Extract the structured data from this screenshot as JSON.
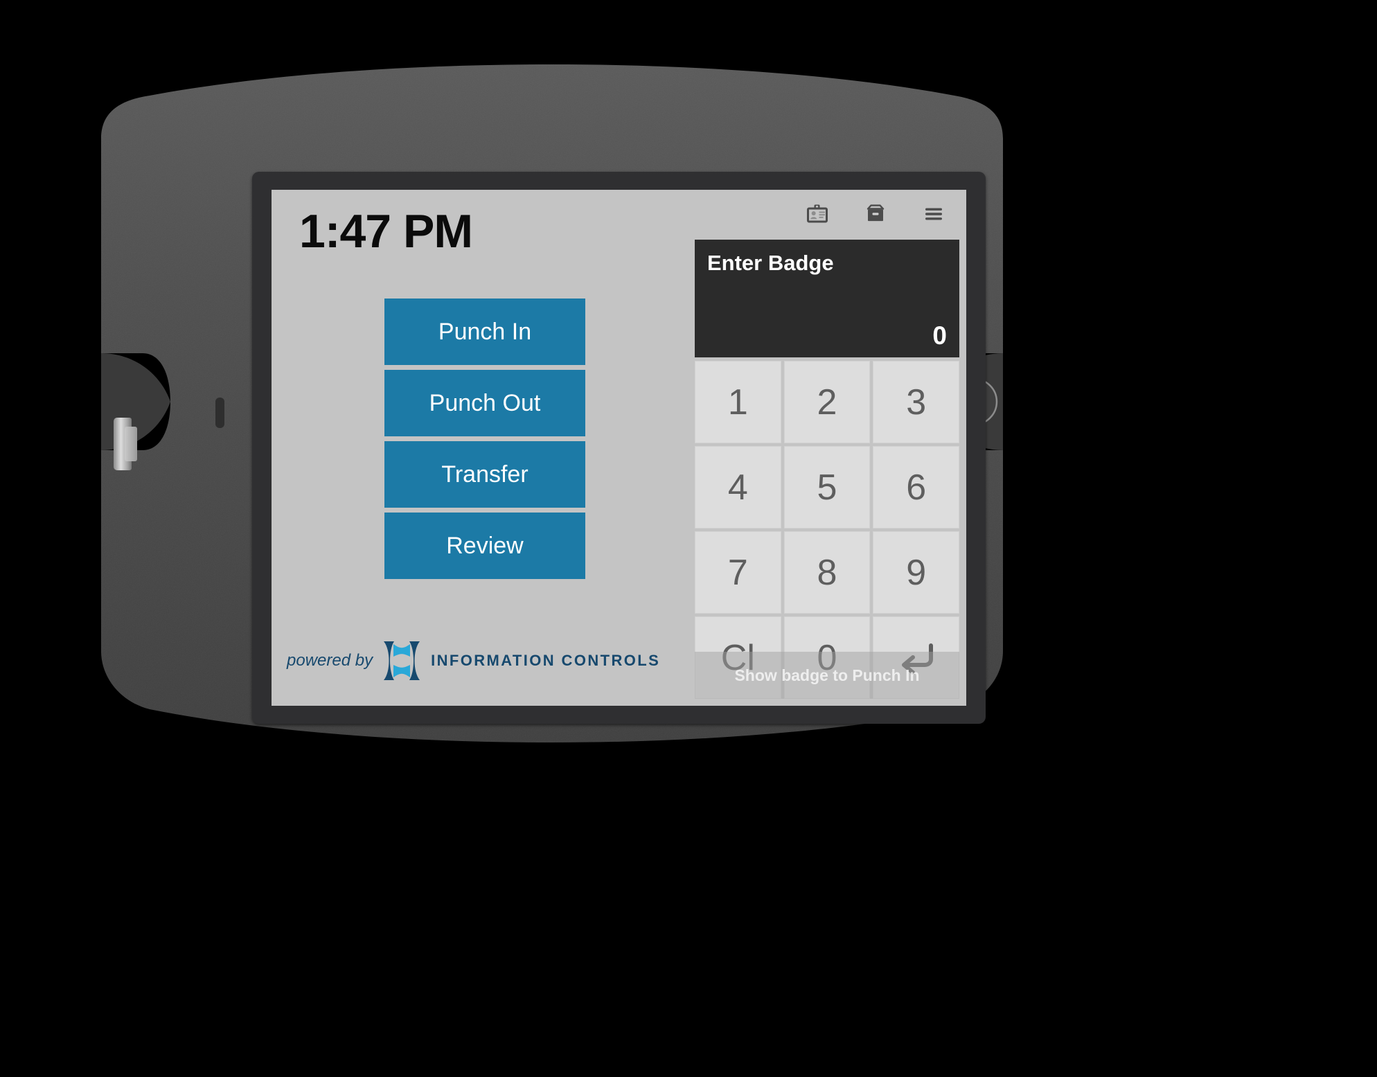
{
  "device": {
    "type": "tablet-kiosk-enclosure",
    "shell_color": "#4b4b4b",
    "bezel_color": "#2f2f31"
  },
  "screen": {
    "background": "#c4c4c4",
    "accent_color": "#1c7aa6",
    "panel_color": "#2b2b2b",
    "key_color": "#dddddd"
  },
  "header": {
    "clock": "1:47 PM",
    "icons": [
      {
        "name": "badge-icon",
        "label": "Badge"
      },
      {
        "name": "archive-box-icon",
        "label": "Archive"
      },
      {
        "name": "hamburger-menu-icon",
        "label": "Menu"
      }
    ]
  },
  "actions": [
    {
      "label": "Punch In"
    },
    {
      "label": "Punch Out"
    },
    {
      "label": "Transfer"
    },
    {
      "label": "Review"
    }
  ],
  "badge_entry": {
    "title": "Enter Badge",
    "value": "0",
    "hint": "Show badge to Punch In"
  },
  "keypad": {
    "keys": [
      {
        "label": "1",
        "name": "key-1"
      },
      {
        "label": "2",
        "name": "key-2"
      },
      {
        "label": "3",
        "name": "key-3"
      },
      {
        "label": "4",
        "name": "key-4"
      },
      {
        "label": "5",
        "name": "key-5"
      },
      {
        "label": "6",
        "name": "key-6"
      },
      {
        "label": "7",
        "name": "key-7"
      },
      {
        "label": "8",
        "name": "key-8"
      },
      {
        "label": "9",
        "name": "key-9"
      },
      {
        "label": "Cl",
        "name": "key-clear"
      },
      {
        "label": "0",
        "name": "key-0"
      },
      {
        "label": "",
        "name": "key-enter"
      }
    ]
  },
  "footer": {
    "powered_by": "powered by",
    "brand": "INFORMATION CONTROLS",
    "brand_color": "#17496e",
    "logo_accent": "#29a8d8"
  }
}
